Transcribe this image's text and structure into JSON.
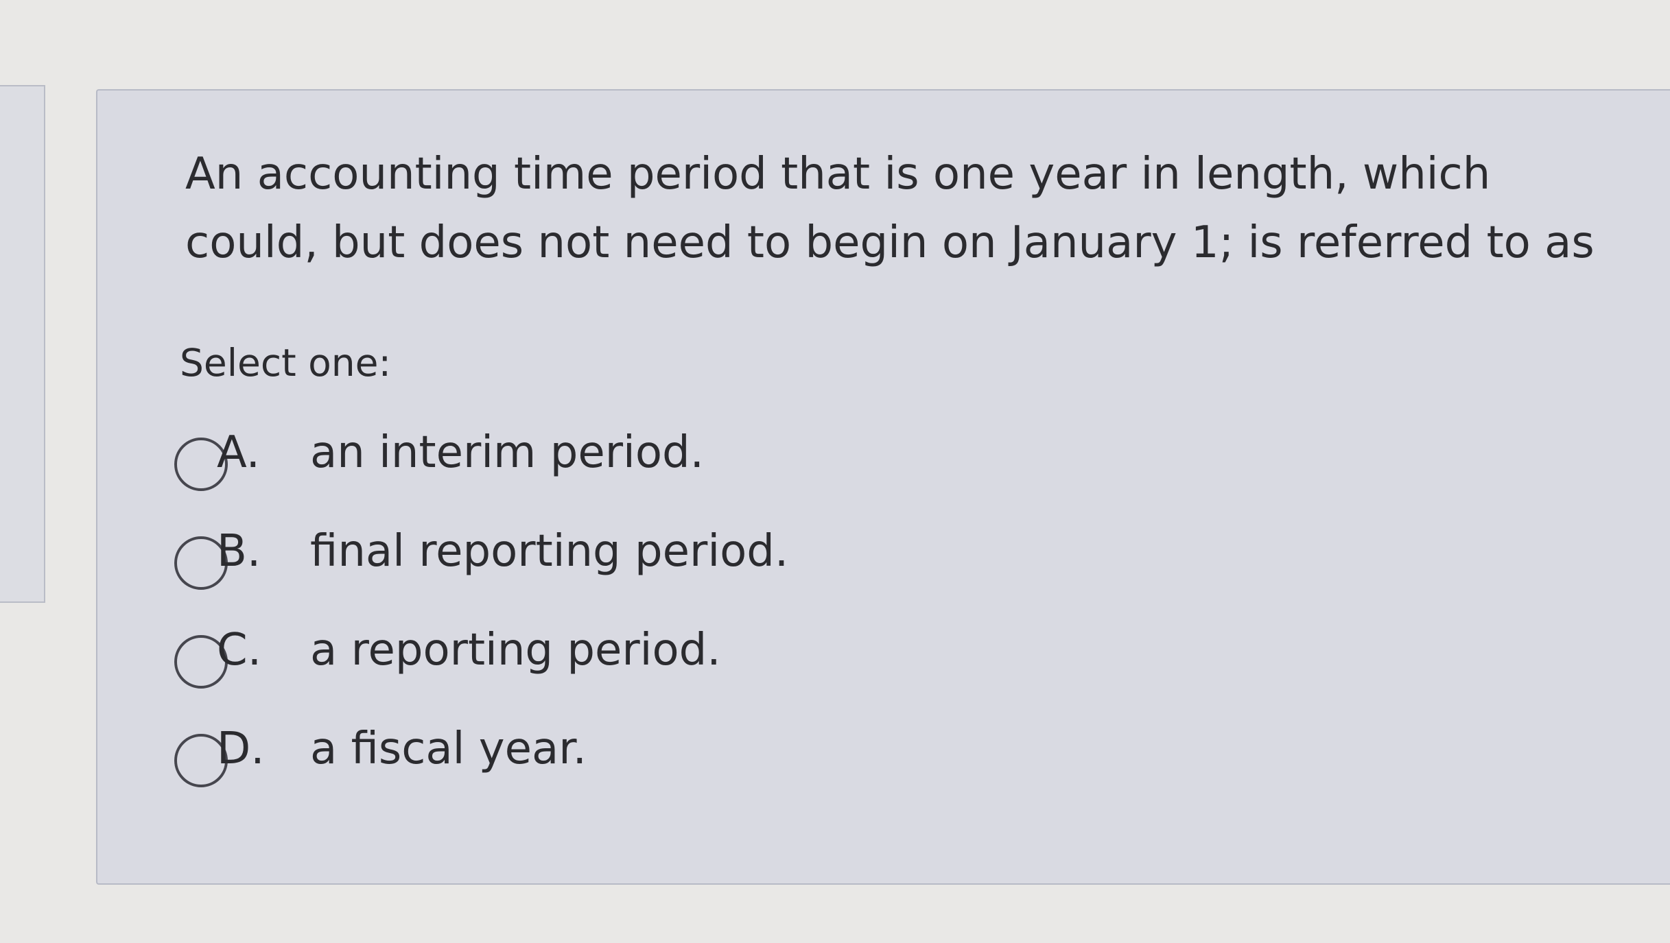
{
  "question": {
    "line1": "An accounting time period that is one year in length, which",
    "line2": "could, but does not need to begin on January 1; is referred to as"
  },
  "prompt": "Select one:",
  "options": [
    {
      "letter": "A.",
      "text": "an interim period."
    },
    {
      "letter": "B.",
      "text": "final reporting period."
    },
    {
      "letter": "C.",
      "text": "a reporting period."
    },
    {
      "letter": "D.",
      "text": "a fiscal year."
    }
  ],
  "colors": {
    "background": "#e9e8e6",
    "card": "#d9dae2",
    "text": "#2b2b2f"
  }
}
